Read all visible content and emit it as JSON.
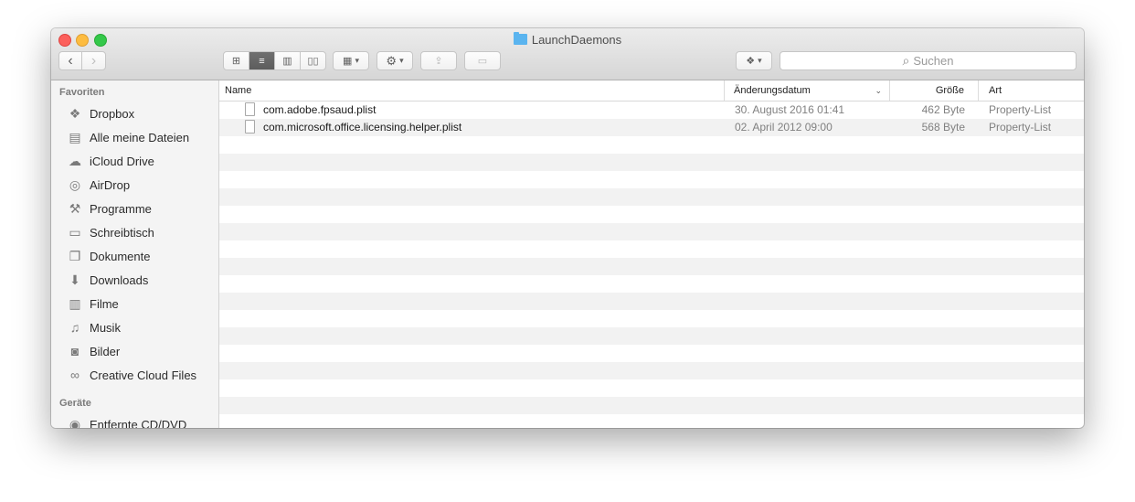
{
  "window": {
    "title": "LaunchDaemons",
    "icon": "folder-icon"
  },
  "toolbar": {
    "search_placeholder": "Suchen",
    "search_icon": "⌕"
  },
  "sidebar": {
    "sections": [
      {
        "header": "Favoriten",
        "items": [
          {
            "label": "Dropbox",
            "icon": "dropbox-icon"
          },
          {
            "label": "Alle meine Dateien",
            "icon": "all-files-icon"
          },
          {
            "label": "iCloud Drive",
            "icon": "cloud-icon"
          },
          {
            "label": "AirDrop",
            "icon": "airdrop-icon"
          },
          {
            "label": "Programme",
            "icon": "applications-icon"
          },
          {
            "label": "Schreibtisch",
            "icon": "desktop-icon"
          },
          {
            "label": "Dokumente",
            "icon": "documents-icon"
          },
          {
            "label": "Downloads",
            "icon": "downloads-icon"
          },
          {
            "label": "Filme",
            "icon": "movies-icon"
          },
          {
            "label": "Musik",
            "icon": "music-icon"
          },
          {
            "label": "Bilder",
            "icon": "pictures-icon"
          },
          {
            "label": "Creative Cloud Files",
            "icon": "creative-cloud-icon"
          }
        ]
      },
      {
        "header": "Geräte",
        "items": [
          {
            "label": "Entfernte CD/DVD",
            "icon": "disc-icon"
          }
        ]
      }
    ]
  },
  "list": {
    "columns": {
      "name": "Name",
      "date": "Änderungsdatum",
      "size": "Größe",
      "kind": "Art"
    },
    "rows": [
      {
        "name": "com.adobe.fpsaud.plist",
        "date": "30. August 2016 01:41",
        "size": "462 Byte",
        "kind": "Property-List"
      },
      {
        "name": "com.microsoft.office.licensing.helper.plist",
        "date": "02. April 2012 09:00",
        "size": "568 Byte",
        "kind": "Property-List"
      }
    ]
  }
}
